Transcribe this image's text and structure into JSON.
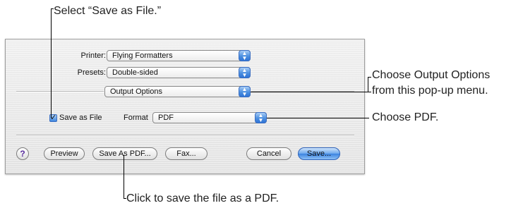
{
  "callouts": {
    "select_save_as_file": "Select “Save as File.”",
    "output_options_line1": "Choose Output Options",
    "output_options_line2": "from this pop-up menu.",
    "choose_pdf": "Choose PDF.",
    "save_as_pdf": "Click to save the file as a PDF."
  },
  "dialog": {
    "printer_label": "Printer:",
    "printer_value": "Flying Formatters",
    "presets_label": "Presets:",
    "presets_value": "Double-sided",
    "section_value": "Output Options",
    "save_as_file_label": "Save as File",
    "save_as_file_checked": true,
    "format_label": "Format",
    "format_value": "PDF",
    "buttons": {
      "help": "?",
      "preview": "Preview",
      "save_as_pdf": "Save As PDF...",
      "fax": "Fax...",
      "cancel": "Cancel",
      "save": "Save..."
    }
  },
  "icons": {
    "popup_arrows": "updown-arrows",
    "checkbox_mark": "checkmark",
    "help": "question-mark"
  }
}
